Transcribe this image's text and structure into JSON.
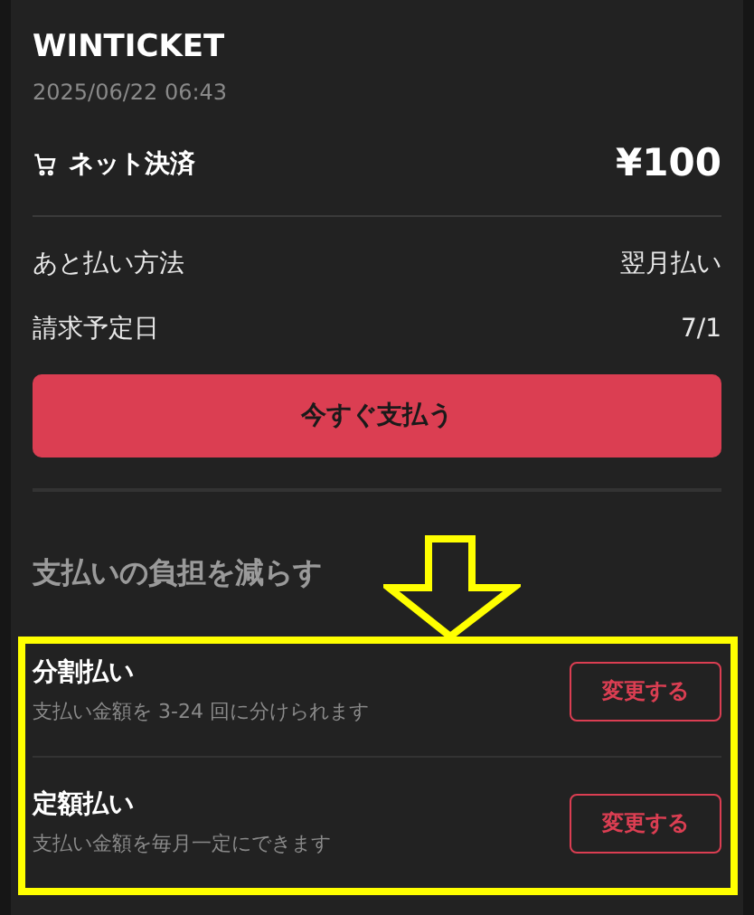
{
  "merchant": {
    "name": "WINTICKET",
    "datetime": "2025/06/22 06:43"
  },
  "payment": {
    "method": "ネット決済",
    "amount": "¥100"
  },
  "details": [
    {
      "label": "あと払い方法",
      "value": "翌月払い"
    },
    {
      "label": "請求予定日",
      "value": "7/1"
    }
  ],
  "pay_button": "今すぐ支払う",
  "section_title": "支払いの負担を減らす",
  "options": [
    {
      "title": "分割払い",
      "description": "支払い金額を 3-24 回に分けられます",
      "button": "変更する"
    },
    {
      "title": "定額払い",
      "description": "支払い金額を毎月一定にできます",
      "button": "変更する"
    }
  ]
}
